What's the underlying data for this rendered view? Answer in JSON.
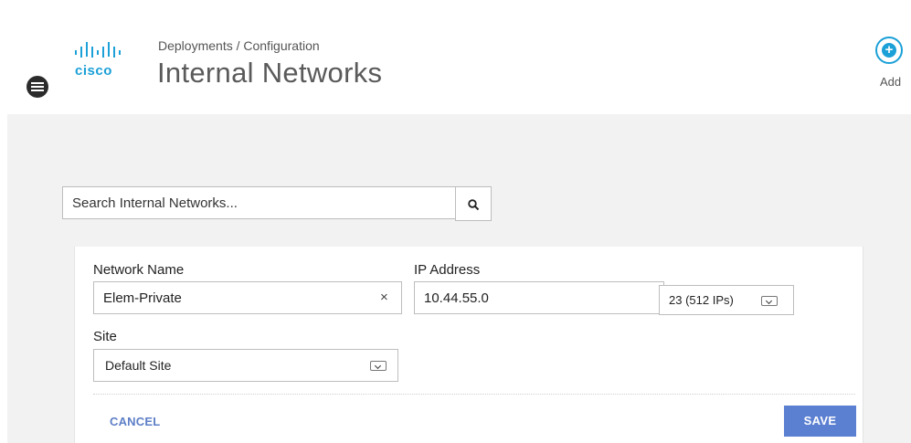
{
  "header": {
    "breadcrumb": "Deployments / Configuration",
    "title": "Internal Networks",
    "logo_text": "cisco",
    "add_label": "Add"
  },
  "search": {
    "placeholder": "Search Internal Networks...",
    "value": ""
  },
  "form": {
    "network_name": {
      "label": "Network Name",
      "value": "Elem-Private",
      "clear_glyph": "×"
    },
    "ip_address": {
      "label": "IP Address",
      "value": "10.44.55.0"
    },
    "prefix": {
      "selected": "23 (512 IPs)"
    },
    "site": {
      "label": "Site",
      "selected": "Default Site"
    },
    "cancel_label": "CANCEL",
    "save_label": "SAVE"
  },
  "colors": {
    "brand": "#1ba0d7",
    "save_button": "#5b7fd1",
    "cancel_text": "#5e7fc7",
    "content_bg": "#f2f2f2"
  },
  "icons": {
    "menu": "hamburger-menu-icon",
    "add": "plus-circle-icon",
    "search": "search-icon",
    "dropdown": "chevron-down-icon"
  }
}
